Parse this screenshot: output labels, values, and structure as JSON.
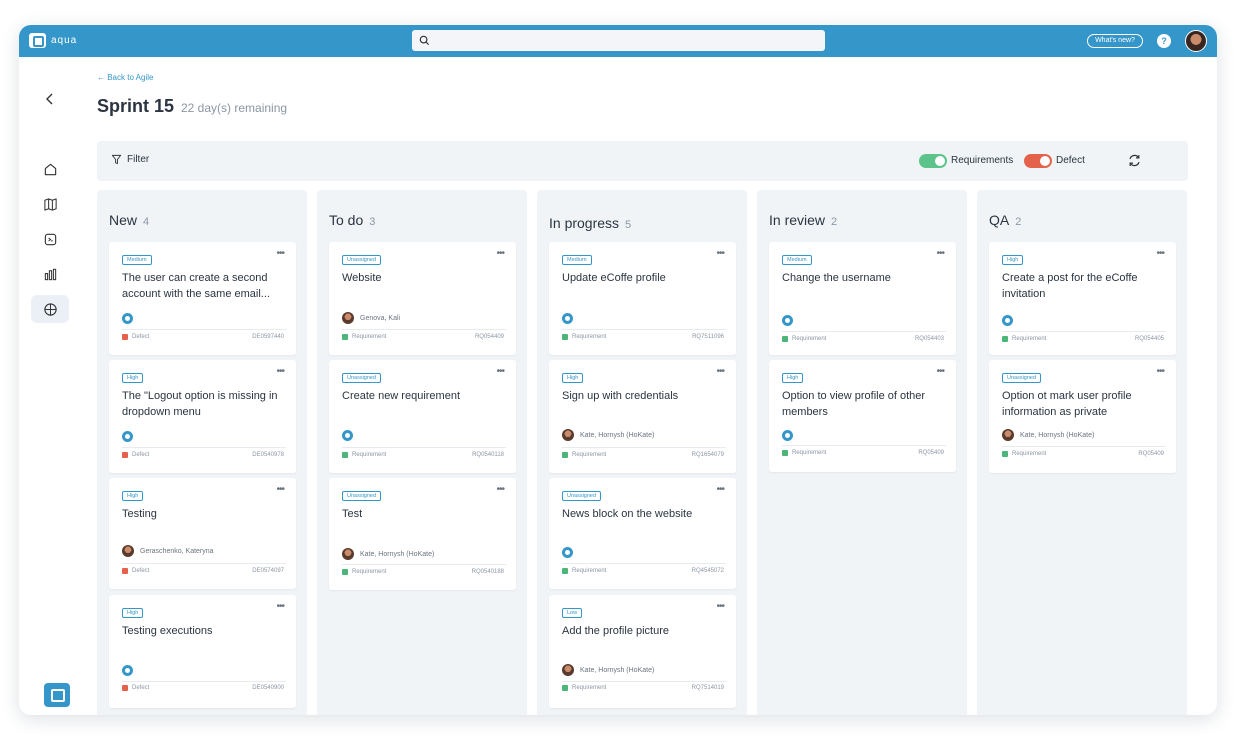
{
  "app": {
    "logo_text": "aqua",
    "whats_new": "What's new?",
    "help": "?"
  },
  "page": {
    "back_link": "← Back to Agile",
    "title": "Sprint 15",
    "remaining": "22 day(s) remaining"
  },
  "filterbar": {
    "filter_label": "Filter",
    "requirements_label": "Requirements",
    "defect_label": "Defect"
  },
  "colors": {
    "accent": "#3597c9",
    "requirements_toggle": "#5cc48a",
    "defect_toggle": "#e5624a",
    "defect_icon": "#e5624a",
    "requirement_icon": "#4cb57a"
  },
  "columns": [
    {
      "title": "New",
      "count": "4",
      "cards": [
        {
          "tag": "Medium",
          "title": "The user can create a second account with the same email...",
          "assignee": "",
          "type": "Defect",
          "id": "DE0597440"
        },
        {
          "tag": "High",
          "title": "The \"Logout option is missing in dropdown menu",
          "assignee": "",
          "type": "Defect",
          "id": "DE0540978"
        },
        {
          "tag": "High",
          "title": "Testing",
          "assignee": "Geraschenko, Kateryna",
          "type": "Defect",
          "id": "DE0574097"
        },
        {
          "tag": "High",
          "title": "Testing executions",
          "assignee": "",
          "type": "Defect",
          "id": "DE0540900"
        }
      ]
    },
    {
      "title": "To do",
      "count": "3",
      "cards": [
        {
          "tag": "Unassigned",
          "title": "Website",
          "assignee": "Genova, Kali",
          "type": "Requirement",
          "id": "RQ054409"
        },
        {
          "tag": "Unassigned",
          "title": "Create new requirement",
          "assignee": "",
          "type": "Requirement",
          "id": "RQ0540118"
        },
        {
          "tag": "Unassigned",
          "title": "Test",
          "assignee": "Kate, Hornysh (HoKate)",
          "type": "Requirement",
          "id": "RQ0540188"
        }
      ]
    },
    {
      "title": "In progress",
      "count": "5",
      "cards": [
        {
          "tag": "Medium",
          "title": "Update eCoffe profile",
          "assignee": "",
          "type": "Requirement",
          "id": "RQ7511096"
        },
        {
          "tag": "High",
          "title": "Sign up with credentials",
          "assignee": "Kate, Hornysh (HoKate)",
          "type": "Requirement",
          "id": "RQ1654079"
        },
        {
          "tag": "Unassigned",
          "title": "News block on the website",
          "assignee": "",
          "type": "Requirement",
          "id": "RQ4545072"
        },
        {
          "tag": "Low",
          "title": "Add the profile picture",
          "assignee": "Kate, Hornysh (HoKate)",
          "type": "Requirement",
          "id": "RQ7514019"
        }
      ]
    },
    {
      "title": "In review",
      "count": "2",
      "cards": [
        {
          "tag": "Medium",
          "title": "Change the username",
          "assignee": "",
          "type": "Requirement",
          "id": "RQ054403"
        },
        {
          "tag": "High",
          "title": "Option to view profile of other members",
          "assignee": "",
          "type": "Requirement",
          "id": "RQ05409"
        }
      ]
    },
    {
      "title": "QA",
      "count": "2",
      "cards": [
        {
          "tag": "High",
          "title": "Create a post for the eCoffe invitation",
          "assignee": "",
          "type": "Requirement",
          "id": "RQ054405"
        },
        {
          "tag": "Unassigned",
          "title": "Option ot mark user profile information as private",
          "assignee": "Kate, Hornysh (HoKate)",
          "type": "Requirement",
          "id": "RQ05409"
        }
      ]
    }
  ]
}
